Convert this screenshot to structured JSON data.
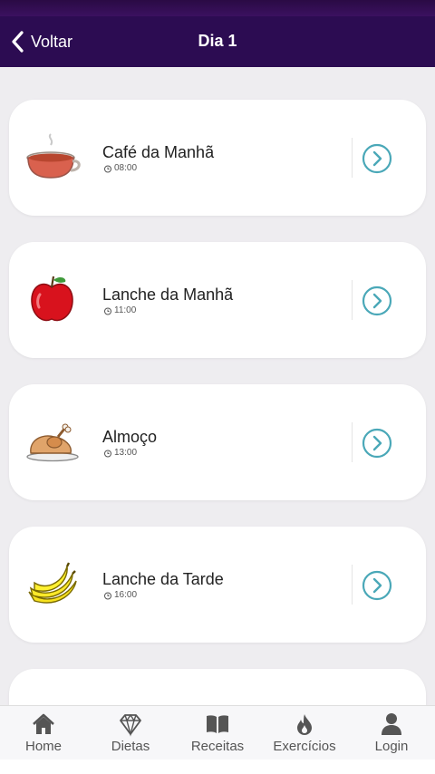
{
  "header": {
    "back_label": "Voltar",
    "title": "Dia 1"
  },
  "meals": [
    {
      "name": "Café da Manhã",
      "time": "08:00",
      "icon": "coffee-cup-icon"
    },
    {
      "name": "Lanche da Manhã",
      "time": "11:00",
      "icon": "apple-icon"
    },
    {
      "name": "Almoço",
      "time": "13:00",
      "icon": "roast-chicken-icon"
    },
    {
      "name": "Lanche da Tarde",
      "time": "16:00",
      "icon": "banana-icon"
    }
  ],
  "tabs": [
    {
      "label": "Home",
      "icon": "home-icon"
    },
    {
      "label": "Dietas",
      "icon": "diamond-icon"
    },
    {
      "label": "Receitas",
      "icon": "book-icon"
    },
    {
      "label": "Exercícios",
      "icon": "flame-icon"
    },
    {
      "label": "Login",
      "icon": "user-icon"
    }
  ],
  "colors": {
    "header_bg": "#2c0c52",
    "accent": "#4aa8b8",
    "content_bg": "#eeedf0"
  }
}
